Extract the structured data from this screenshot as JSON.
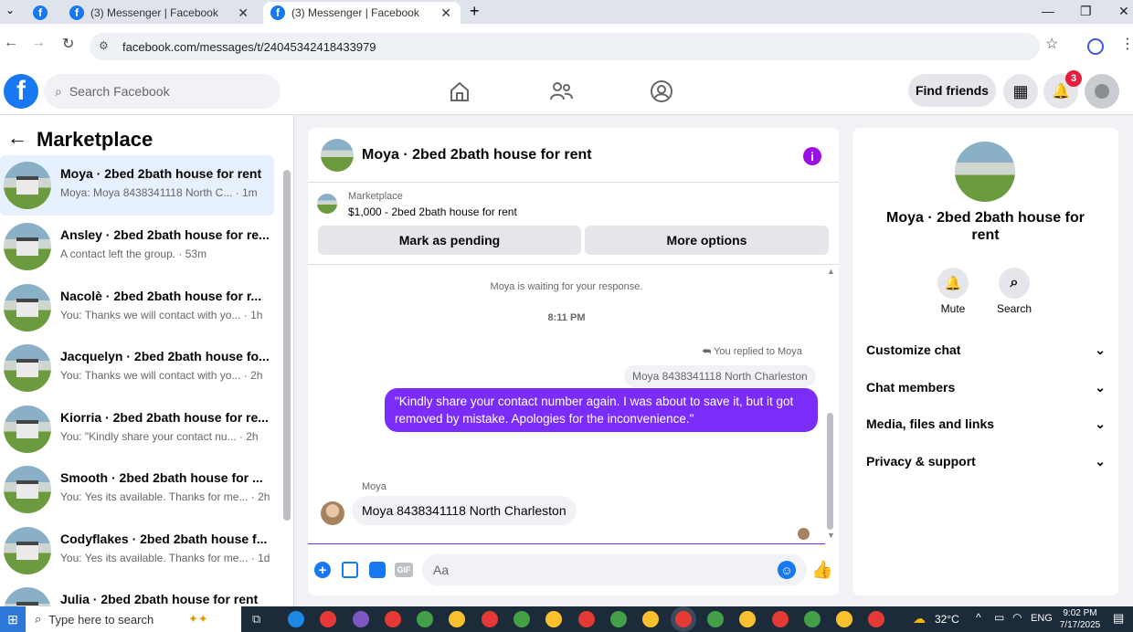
{
  "browser": {
    "tabs": [
      {
        "label": "(3) Messenger | Facebook"
      },
      {
        "label": "(3) Messenger | Facebook"
      }
    ],
    "new_tab": "+",
    "url": "facebook.com/messages/t/24045342418433979"
  },
  "fb": {
    "logo": "f",
    "search_placeholder": "Search Facebook",
    "find_friends": "Find friends",
    "notif_count": "3"
  },
  "left": {
    "title": "Marketplace",
    "conversations": [
      {
        "name": "Moya · 2bed 2bath house for rent",
        "sub": "Moya: Moya 8438341118 North C... · 1m"
      },
      {
        "name": "Ansley · 2bed 2bath house for re...",
        "sub": "A contact left the group. · 53m"
      },
      {
        "name": "Nacolè · 2bed 2bath house for r...",
        "sub": "You: Thanks we will contact with yo... · 1h"
      },
      {
        "name": "Jacquelyn · 2bed 2bath house fo...",
        "sub": "You: Thanks we will contact with yo... · 2h"
      },
      {
        "name": "Kiorria · 2bed 2bath house for re...",
        "sub": "You: \"Kindly share your contact nu... · 2h"
      },
      {
        "name": "Smooth · 2bed 2bath house for ...",
        "sub": "You: Yes its available. Thanks for me... · 2h"
      },
      {
        "name": "Codyflakes · 2bed 2bath house f...",
        "sub": "You: Yes its available. Thanks for me... · 1d"
      },
      {
        "name": "Julia · 2bed 2bath house for rent",
        "sub": ""
      }
    ]
  },
  "chat": {
    "title": "Moya · 2bed 2bath house for rent",
    "listing_source": "Marketplace",
    "listing_detail": "$1,000 - 2bed 2bath house for rent",
    "mark_pending": "Mark as pending",
    "more_options": "More options",
    "waiting": "Moya is waiting for your response.",
    "time": "8:11 PM",
    "replied_to": "You replied to Moya",
    "quoted": "Moya 8438341118 North Charleston",
    "sent_message": "\"Kindly share your contact number again. I was about to save it, but it got removed by mistake. Apologies for the inconvenience.\"",
    "sender_name": "Moya",
    "received_message": "Moya 8438341118 North Charleston",
    "composer_placeholder": "Aa",
    "gif_label": "GIF"
  },
  "right": {
    "name": "Moya · 2bed 2bath house for rent",
    "mute": "Mute",
    "search": "Search",
    "sections": [
      "Customize chat",
      "Chat members",
      "Media, files and links",
      "Privacy & support"
    ]
  },
  "taskbar": {
    "search_placeholder": "Type here to search",
    "temperature": "32°C",
    "lang": "ENG",
    "time": "9:02 PM",
    "date": "7/17/2025"
  },
  "colors": {
    "accent": "#1877f2",
    "messenger_purple": "#7a2cf8",
    "info_purple": "#9b10e0"
  }
}
